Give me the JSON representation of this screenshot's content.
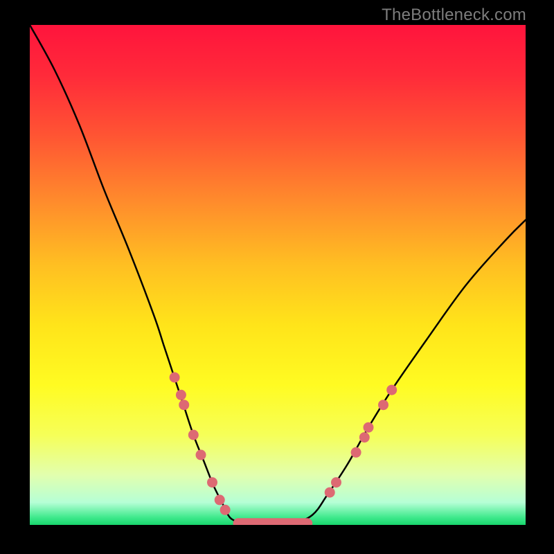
{
  "watermark": "TheBottleneck.com",
  "colors": {
    "background": "#000000",
    "watermark_text": "#7d7d7d",
    "curve": "#000000",
    "marker": "#dd6973",
    "gradient_stops": [
      {
        "offset": 0.0,
        "color": "#ff143c"
      },
      {
        "offset": 0.1,
        "color": "#ff2a3a"
      },
      {
        "offset": 0.22,
        "color": "#ff5433"
      },
      {
        "offset": 0.35,
        "color": "#ff8a2c"
      },
      {
        "offset": 0.48,
        "color": "#ffbf22"
      },
      {
        "offset": 0.6,
        "color": "#ffe41a"
      },
      {
        "offset": 0.72,
        "color": "#fffb22"
      },
      {
        "offset": 0.82,
        "color": "#f6ff58"
      },
      {
        "offset": 0.9,
        "color": "#e2ffae"
      },
      {
        "offset": 0.955,
        "color": "#b6ffd6"
      },
      {
        "offset": 0.985,
        "color": "#3fe98c"
      },
      {
        "offset": 1.0,
        "color": "#18d66d"
      }
    ]
  },
  "chart_data": {
    "type": "line",
    "title": "",
    "xlabel": "",
    "ylabel": "",
    "x_range": [
      0,
      100
    ],
    "y_range": [
      0,
      100
    ],
    "series": [
      {
        "name": "bottleneck-curve",
        "x": [
          0,
          5,
          10,
          15,
          20,
          25,
          27,
          29,
          31,
          33,
          35,
          37,
          39,
          40,
          41,
          43,
          47,
          50,
          53,
          57,
          60,
          64,
          68,
          73,
          80,
          88,
          96,
          100
        ],
        "y": [
          100,
          91,
          80,
          67,
          55,
          42,
          36,
          30,
          24,
          18,
          13,
          8,
          4,
          2,
          1,
          0.3,
          0.3,
          0.3,
          0.3,
          2,
          6,
          12,
          19,
          27,
          37,
          48,
          57,
          61
        ]
      }
    ],
    "markers": {
      "left_cluster": [
        {
          "x": 29.2,
          "y": 29.5
        },
        {
          "x": 30.5,
          "y": 26.0
        },
        {
          "x": 31.1,
          "y": 24.0
        },
        {
          "x": 33.0,
          "y": 18.0
        },
        {
          "x": 34.5,
          "y": 14.0
        },
        {
          "x": 36.8,
          "y": 8.5
        },
        {
          "x": 38.3,
          "y": 5.0
        },
        {
          "x": 39.4,
          "y": 3.0
        }
      ],
      "right_cluster": [
        {
          "x": 60.5,
          "y": 6.5
        },
        {
          "x": 61.8,
          "y": 8.5
        },
        {
          "x": 65.8,
          "y": 14.5
        },
        {
          "x": 67.5,
          "y": 17.5
        },
        {
          "x": 68.3,
          "y": 19.5
        },
        {
          "x": 71.3,
          "y": 24.0
        },
        {
          "x": 73.0,
          "y": 27.0
        }
      ],
      "bottom_bar": {
        "x_start": 41.0,
        "x_end": 57.0,
        "y": 0.3
      }
    }
  }
}
